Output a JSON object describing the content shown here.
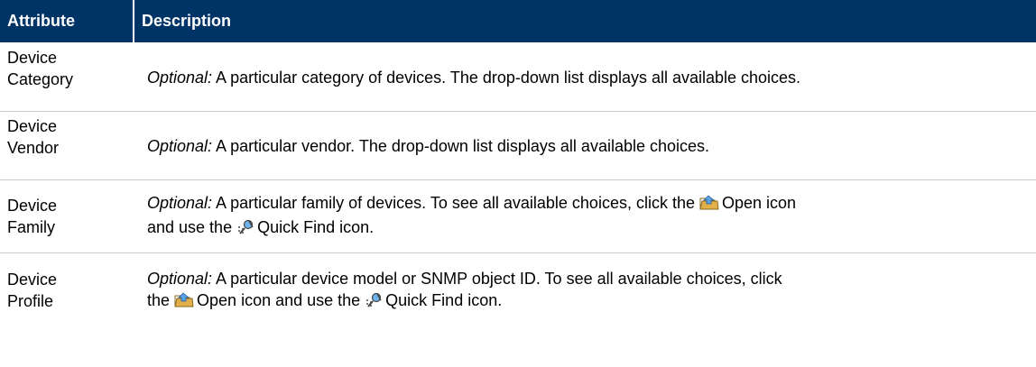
{
  "header": {
    "col1": "Attribute",
    "col2": "Description"
  },
  "rows": [
    {
      "name_line1": "Device",
      "name_line2": "Category",
      "optional": "Optional:",
      "text": " A particular category of devices. The drop-down list displays all available choices."
    },
    {
      "name_line1": "Device",
      "name_line2": "Vendor",
      "optional": "Optional:",
      "text": " A particular vendor. The drop-down list displays all available choices."
    },
    {
      "name_line1": "Device",
      "name_line2": "Family",
      "optional": "Optional:",
      "text_a": " A particular family of devices. To see all available choices, click the ",
      "text_b": "Open icon",
      "text_c": "and use the ",
      "text_d": "Quick Find icon."
    },
    {
      "name_line1": "Device",
      "name_line2": "Profile",
      "optional": "Optional:",
      "text_a": " A particular device model or SNMP object ID. To see all available choices, click",
      "text_b": "the ",
      "text_c": "Open icon and use the ",
      "text_d": "Quick Find icon."
    }
  ],
  "icons": {
    "open": "open-folder-icon",
    "quick_find": "quick-find-icon"
  },
  "colors": {
    "header_bg": "#003466",
    "header_text": "#ffffff",
    "row_border": "#c9c9c9"
  }
}
